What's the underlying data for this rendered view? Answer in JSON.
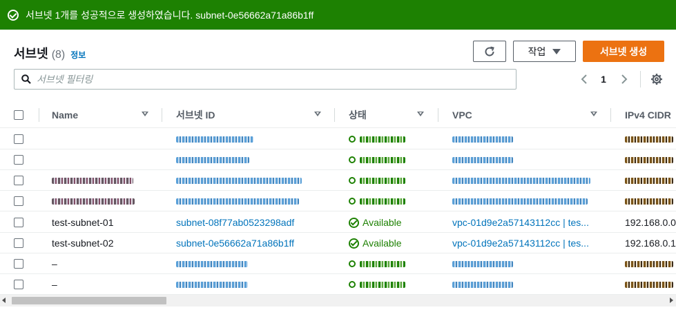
{
  "flash": {
    "message": "서브넷 1개를 성공적으로 생성하였습니다. subnet-0e56662a71a86b1ff"
  },
  "header": {
    "title": "서브넷",
    "count": "(8)",
    "info_link": "정보"
  },
  "toolbar": {
    "action_label": "작업",
    "create_label": "서브넷 생성"
  },
  "search": {
    "placeholder": "서브넷 필터링",
    "value": ""
  },
  "pagination": {
    "current_page": "1"
  },
  "table": {
    "columns": [
      "Name",
      "서브넷 ID",
      "상태",
      "VPC",
      "IPv4 CIDR"
    ],
    "rows": [
      {
        "name": "",
        "subnet_id": "",
        "status": "",
        "vpc": "",
        "cidr": "",
        "redacted": true
      },
      {
        "name": "",
        "subnet_id": "",
        "status": "",
        "vpc": "",
        "cidr": "",
        "redacted": true
      },
      {
        "name": "",
        "subnet_id": "",
        "status": "",
        "vpc": "",
        "cidr": "",
        "redacted": true
      },
      {
        "name": "",
        "subnet_id": "",
        "status": "",
        "vpc": "",
        "cidr": "",
        "redacted": true
      },
      {
        "name": "test-subnet-01",
        "subnet_id": "subnet-08f77ab0523298adf",
        "status": "Available",
        "vpc": "vpc-01d9e2a57143112cc | tes...",
        "cidr": "192.168.0.0",
        "redacted": false
      },
      {
        "name": "test-subnet-02",
        "subnet_id": "subnet-0e56662a71a86b1ff",
        "status": "Available",
        "vpc": "vpc-01d9e2a57143112cc | tes...",
        "cidr": "192.168.0.1",
        "redacted": false
      },
      {
        "name": "–",
        "subnet_id": "",
        "status": "",
        "vpc": "",
        "cidr": "",
        "redacted": true
      },
      {
        "name": "–",
        "subnet_id": "",
        "status": "",
        "vpc": "",
        "cidr": "",
        "redacted": true
      }
    ]
  },
  "colors": {
    "success": "#1d8102",
    "primary": "#ec7211",
    "link": "#0073bb"
  },
  "icons": [
    "check-circle-icon",
    "refresh-icon",
    "caret-down-icon",
    "search-icon",
    "chevron-left-icon",
    "chevron-right-icon",
    "gear-icon",
    "sort-icon"
  ]
}
